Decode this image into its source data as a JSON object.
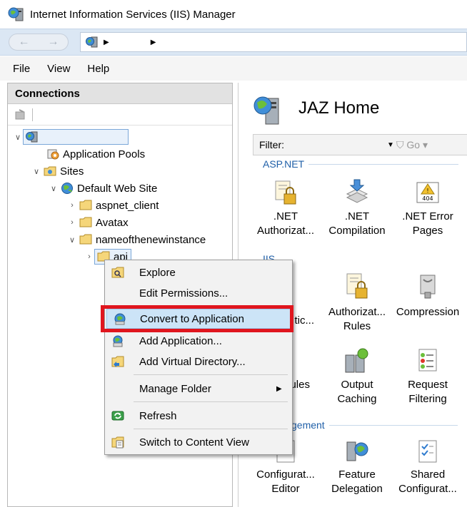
{
  "window": {
    "title": "Internet Information Services (IIS) Manager"
  },
  "menu": {
    "file": "File",
    "view": "View",
    "help": "Help"
  },
  "connections": {
    "header": "Connections",
    "tree": {
      "app_pools": "Application Pools",
      "sites": "Sites",
      "default_site": "Default Web Site",
      "aspnet_client": "aspnet_client",
      "avatax": "Avatax",
      "new_instance": "nameofthenewinstance",
      "api": "api"
    }
  },
  "home": {
    "title": "JAZ Home",
    "filter_label": "Filter:",
    "go_label": "Go",
    "groups": {
      "aspnet": "ASP.NET",
      "iis": "IIS",
      "management": "gement"
    },
    "features": {
      "net_auth": {
        "line1": ".NET",
        "line2": "Authorizat..."
      },
      "net_comp": {
        "line1": ".NET",
        "line2": "Compilation"
      },
      "net_error": {
        "line1": ".NET Error",
        "line2": "Pages"
      },
      "auth_partial": "tic...",
      "auth_rules": {
        "line1": "Authorizat...",
        "line2": "Rules"
      },
      "compression": "Compression",
      "modules_partial": "ules",
      "output_caching": {
        "line1": "Output",
        "line2": "Caching"
      },
      "request_filtering": {
        "line1": "Request",
        "line2": "Filtering"
      },
      "config_editor": {
        "line1": "Configurat...",
        "line2": "Editor"
      },
      "feature_delegation": {
        "line1": "Feature",
        "line2": "Delegation"
      },
      "shared_config": {
        "line1": "Shared",
        "line2": "Configurat..."
      }
    }
  },
  "context_menu": {
    "explore": "Explore",
    "edit_permissions": "Edit Permissions...",
    "convert_to_application": "Convert to Application",
    "add_application": "Add Application...",
    "add_virtual_directory": "Add Virtual Directory...",
    "manage_folder": "Manage Folder",
    "refresh": "Refresh",
    "switch_content_view": "Switch to Content View"
  },
  "colors": {
    "highlight": "#cce4f7",
    "annotation": "#e0161e",
    "group_header": "#1f5fa8"
  }
}
